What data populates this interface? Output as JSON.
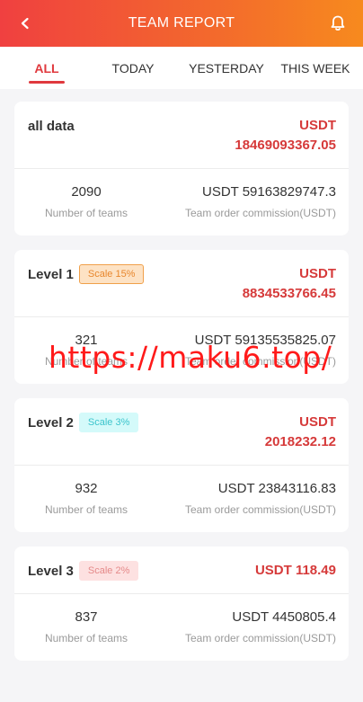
{
  "header": {
    "title": "TEAM REPORT",
    "back_icon": "chevron-left-icon",
    "bell_icon": "bell-icon"
  },
  "tabs": [
    {
      "label": "ALL",
      "active": true
    },
    {
      "label": "TODAY",
      "active": false
    },
    {
      "label": "YESTERDAY",
      "active": false
    },
    {
      "label": "THIS WEEK",
      "active": false
    }
  ],
  "cards": [
    {
      "name": "all data",
      "badge": "",
      "amount_line1": "USDT",
      "amount_line2": "18469093367.05",
      "teams_value": "2090",
      "teams_label": "Number of teams",
      "commission_value": "USDT 59163829747.3",
      "commission_label": "Team order commission(USDT)"
    },
    {
      "name": "Level 1",
      "badge": "Scale 15%",
      "amount_line1": "USDT",
      "amount_line2": "8834533766.45",
      "teams_value": "321",
      "teams_label": "Number of teams",
      "commission_value": "USDT 59135535825.07",
      "commission_label": "Team order commission(USDT)"
    },
    {
      "name": "Level 2",
      "badge": "Scale 3%",
      "amount_line1": "USDT",
      "amount_line2": "2018232.12",
      "teams_value": "932",
      "teams_label": "Number of teams",
      "commission_value": "USDT 23843116.83",
      "commission_label": "Team order commission(USDT)"
    },
    {
      "name": "Level 3",
      "badge": "Scale 2%",
      "amount_line1": "USDT 118.49",
      "amount_line2": "",
      "teams_value": "837",
      "teams_label": "Number of teams",
      "commission_value": "USDT 4450805.4",
      "commission_label": "Team order commission(USDT)"
    }
  ],
  "watermark": "https://maku6.top/",
  "colors": {
    "accent": "#e0393e",
    "header_start": "#f04040",
    "header_end": "#f78a1e"
  }
}
